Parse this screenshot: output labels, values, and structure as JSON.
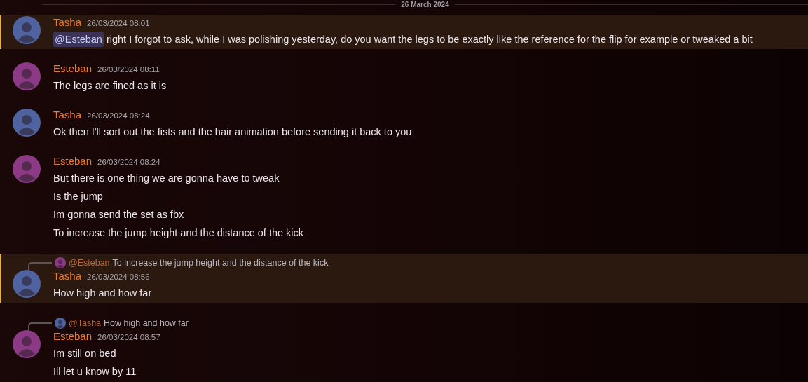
{
  "date_divider": "26 March 2024",
  "messages": [
    {
      "author": "Tasha",
      "avatar": {
        "color": "#4e63a0"
      },
      "timestamp": "26/03/2024 08:01",
      "highlighted": true,
      "mention": "@Esteban",
      "lines": [
        "right I forgot to ask, while I was polishing yesterday, do you want the legs to be exactly like the reference for the flip for example or tweaked a bit"
      ]
    },
    {
      "author": "Esteban",
      "avatar": {
        "color": "#8c3a86"
      },
      "timestamp": "26/03/2024 08:11",
      "highlighted": false,
      "lines": [
        "The legs are fined as it is"
      ]
    },
    {
      "author": "Tasha",
      "avatar": {
        "color": "#4e63a0"
      },
      "timestamp": "26/03/2024 08:24",
      "highlighted": false,
      "lines": [
        "Ok then I'll sort out the fists and the hair animation before sending it back to you"
      ]
    },
    {
      "author": "Esteban",
      "avatar": {
        "color": "#8c3a86"
      },
      "timestamp": "26/03/2024 08:24",
      "highlighted": false,
      "lines": [
        "But there is one thing we are gonna have to tweak",
        "Is the jump",
        "Im gonna send the set as fbx",
        "To increase the jump height and the distance of the kick"
      ]
    },
    {
      "author": "Tasha",
      "avatar": {
        "color": "#4e63a0"
      },
      "timestamp": "26/03/2024 08:56",
      "highlighted": true,
      "reply": {
        "avatar": {
          "color": "#8c3a86"
        },
        "author": "@Esteban",
        "text": "To increase the jump height and the distance of the kick"
      },
      "lines": [
        "How high and how far"
      ]
    },
    {
      "author": "Esteban",
      "avatar": {
        "color": "#8c3a86"
      },
      "timestamp": "26/03/2024 08:57",
      "highlighted": false,
      "reply": {
        "avatar": {
          "color": "#4e63a0"
        },
        "author": "@Tasha",
        "text": "How high and how far"
      },
      "lines": [
        "Im still on bed",
        "Ill let u know by 11"
      ]
    }
  ]
}
